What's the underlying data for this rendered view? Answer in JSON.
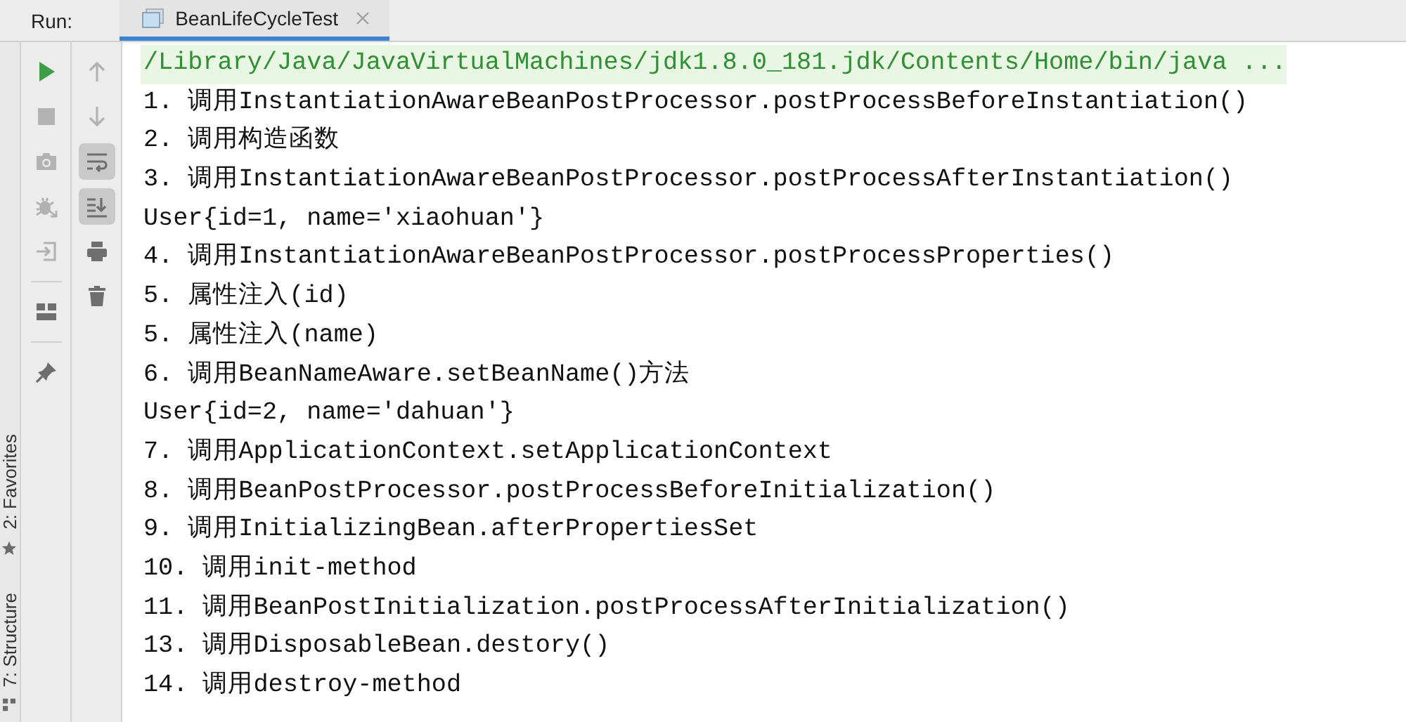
{
  "run_label": "Run:",
  "tabs": [
    {
      "label": "BeanLifeCycleTest",
      "selected": true
    }
  ],
  "side_tabs": [
    {
      "label": "2: Favorites",
      "kind": "favorites"
    },
    {
      "label": "7: Structure",
      "kind": "structure"
    }
  ],
  "run_tool_groups": [
    {
      "tools": [
        {
          "kind": "run",
          "disabled": false
        },
        {
          "kind": "stop",
          "disabled": true
        },
        {
          "kind": "camera",
          "disabled": true
        },
        {
          "kind": "debug",
          "disabled": true
        },
        {
          "kind": "exit",
          "disabled": true
        }
      ]
    },
    {
      "tools": [
        {
          "kind": "layout",
          "disabled": false
        }
      ]
    },
    {
      "tools": [
        {
          "kind": "pin",
          "disabled": false
        }
      ]
    }
  ],
  "console_tools": [
    {
      "kind": "up",
      "disabled": true,
      "on": false
    },
    {
      "kind": "down",
      "disabled": true,
      "on": false
    },
    {
      "kind": "wrap",
      "disabled": false,
      "on": true
    },
    {
      "kind": "scroll",
      "disabled": false,
      "on": true
    },
    {
      "kind": "print",
      "disabled": false,
      "on": false
    },
    {
      "kind": "trash",
      "disabled": false,
      "on": false
    }
  ],
  "console_lines": [
    {
      "kind": "command",
      "text": "/Library/Java/JavaVirtualMachines/jdk1.8.0_181.jdk/Contents/Home/bin/java ..."
    },
    {
      "kind": "output",
      "text": "1. 调用InstantiationAwareBeanPostProcessor.postProcessBeforeInstantiation()"
    },
    {
      "kind": "output",
      "text": "2. 调用构造函数"
    },
    {
      "kind": "output",
      "text": "3. 调用InstantiationAwareBeanPostProcessor.postProcessAfterInstantiation()"
    },
    {
      "kind": "output",
      "text": "User{id=1, name='xiaohuan'}"
    },
    {
      "kind": "output",
      "text": "4. 调用InstantiationAwareBeanPostProcessor.postProcessProperties()"
    },
    {
      "kind": "output",
      "text": "5. 属性注入(id)"
    },
    {
      "kind": "output",
      "text": "5. 属性注入(name)"
    },
    {
      "kind": "output",
      "text": "6. 调用BeanNameAware.setBeanName()方法"
    },
    {
      "kind": "output",
      "text": "User{id=2, name='dahuan'}"
    },
    {
      "kind": "output",
      "text": "7. 调用ApplicationContext.setApplicationContext"
    },
    {
      "kind": "output",
      "text": "8. 调用BeanPostProcessor.postProcessBeforeInitialization()"
    },
    {
      "kind": "output",
      "text": "9. 调用InitializingBean.afterPropertiesSet"
    },
    {
      "kind": "output",
      "text": "10. 调用init-method"
    },
    {
      "kind": "output",
      "text": "11. 调用BeanPostInitialization.postProcessAfterInitialization()"
    },
    {
      "kind": "output",
      "text": "13. 调用DisposableBean.destory()"
    },
    {
      "kind": "output",
      "text": "14. 调用destroy-method"
    }
  ]
}
